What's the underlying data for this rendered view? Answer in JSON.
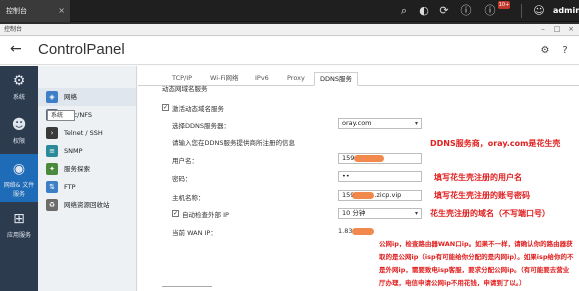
{
  "topbar": {
    "app_tab": "控制台",
    "close": "×",
    "badge": "10+",
    "user": "admin"
  },
  "window": {
    "title": "控制台",
    "min": "–",
    "max": "□",
    "close": "×"
  },
  "header": {
    "back": "←",
    "title": "ControlPanel"
  },
  "categories": [
    {
      "label": "系统",
      "icon": "gear-icon"
    },
    {
      "label": "权限",
      "icon": "user-icon"
    },
    {
      "label": "网络& 文件\n服务",
      "icon": "globe-icon"
    },
    {
      "label": "应用服务",
      "icon": "apps-icon"
    }
  ],
  "submenu": [
    {
      "label": "网络",
      "icon": "network-icon",
      "color": "#3d7fc6"
    },
    {
      "label": "Mac/NFS",
      "icon": "mac-nfs-icon",
      "color": "#5b6d83"
    },
    {
      "label": "Telnet / SSH",
      "icon": "terminal-icon",
      "color": "#3a3a3a"
    },
    {
      "label": "SNMP",
      "icon": "snmp-icon",
      "color": "#2b8a9a"
    },
    {
      "label": "服务探索",
      "icon": "discovery-icon",
      "color": "#4a8a3c"
    },
    {
      "label": "FTP",
      "icon": "ftp-icon",
      "color": "#3d7fc6"
    },
    {
      "label": "网络资源回收站",
      "icon": "recycle-icon",
      "color": "#6b6b6b"
    }
  ],
  "tooltip": "系统",
  "tabs": [
    "TCP/IP",
    "Wi-Fi网络",
    "IPv6",
    "Proxy",
    "DDNS服务"
  ],
  "form": {
    "section_title": "动态网域名服务",
    "enable_label": "激活动态域名服务",
    "enable_checked": "✓",
    "ddns_server_label": "选择DDNS服务器：",
    "ddns_server_value": "oray.com",
    "hint": "请输入您在DDNS服务提供商所注册的信息",
    "username_label": "用户名：",
    "username_value": "159",
    "password_label": "密码：",
    "password_value": "••",
    "hostname_label": "主机名称：",
    "hostname_value_prefix": "159",
    "hostname_value_suffix": ".zicp.vip",
    "auto_check_label": "自动检查外部 IP",
    "auto_check_checked": "✓",
    "interval_value": "10 分钟",
    "wan_ip_label": "当前 WAN IP：",
    "wan_ip_value": "1.83"
  },
  "annotations": {
    "ddns": "DDNS服务商，oray.com是花生壳",
    "username": "填写花生壳注册的用户名",
    "password": "填写花生壳注册的账号密码",
    "hostname": "花生壳注册的域名（不写端口号）",
    "wan_note": "公网ip，检查路由器WAN口ip。如果不一样，请确认你的路由器获取的是公网ip（isp有可能给你分配的是内网ip）。如果isp给你的不是外网ip，需要致电isp客服，要求分配公网ip。（有可能要去营业厅办理，电信申请公网ip不用花钱，申请到了以。）"
  },
  "colors": {
    "accent": "#1e6bb8",
    "annotation": "#e02020",
    "redact": "#f07c3a"
  }
}
